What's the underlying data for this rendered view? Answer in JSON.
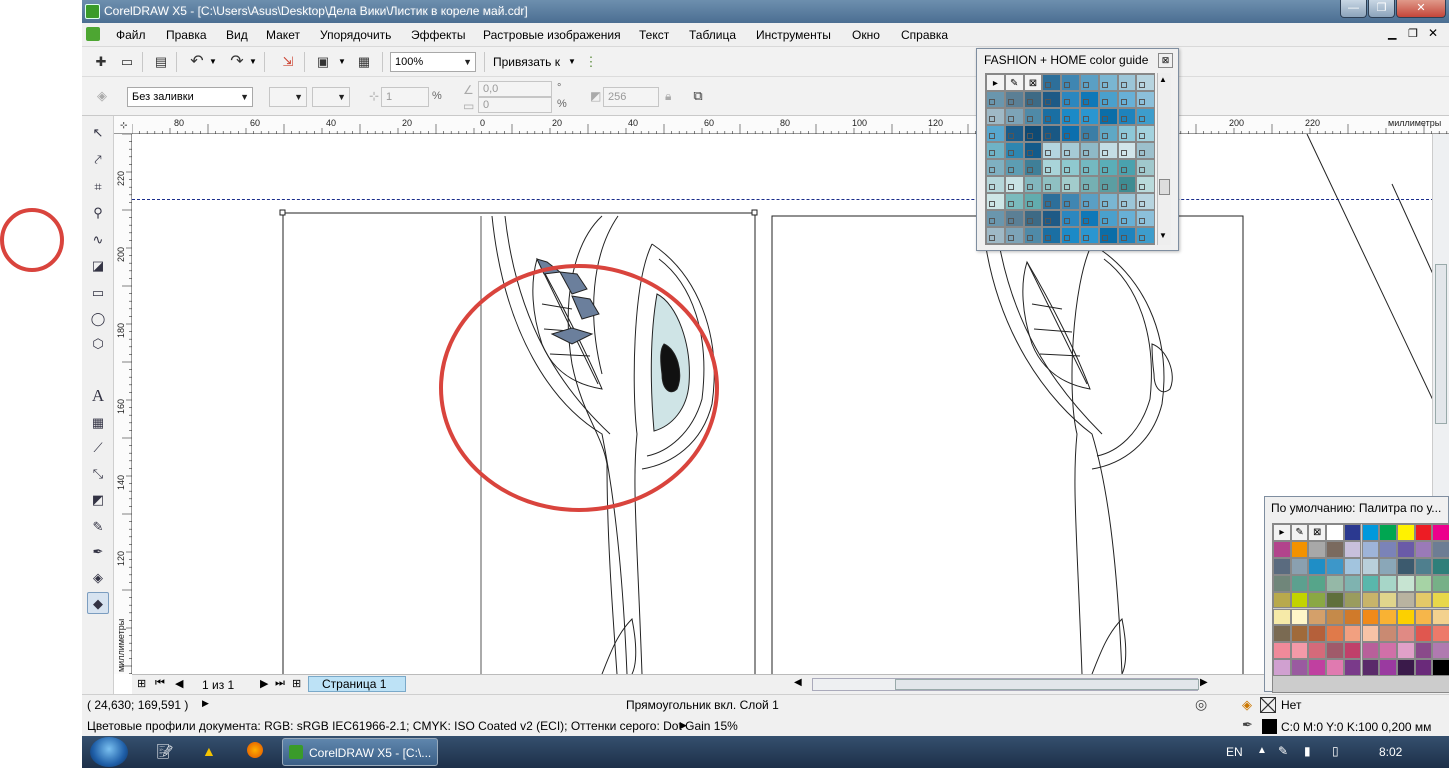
{
  "window": {
    "title": "CorelDRAW X5 - [C:\\Users\\Asus\\Desktop\\Дела Вики\\Листик в кореле май.cdr]",
    "min_glyph": "—",
    "max_glyph": "❐",
    "close_glyph": "✕"
  },
  "menu": {
    "items": [
      "Файл",
      "Правка",
      "Вид",
      "Макет",
      "Упорядочить",
      "Эффекты",
      "Растровые изображения",
      "Текст",
      "Таблица",
      "Инструменты",
      "Окно",
      "Справка"
    ]
  },
  "toolbar": {
    "zoom_value": "100%",
    "snap_label": "Привязать к"
  },
  "property_bar": {
    "fill_value": "Без заливки",
    "outline_width": "1",
    "percent_sign": "%",
    "value_a": "0,0",
    "value_b": "0",
    "angle_sign": "°",
    "percent2": "%",
    "count_value": "256"
  },
  "rulers": {
    "unit": "миллиметры",
    "h_labels": [
      "80",
      "60",
      "40",
      "20",
      "0",
      "20",
      "40",
      "60",
      "80",
      "100",
      "120",
      "200",
      "220"
    ],
    "v_labels": [
      "220",
      "200",
      "180",
      "160",
      "140",
      "120"
    ]
  },
  "page_nav": {
    "counter": "1 из 1",
    "page_tab": "Страница 1"
  },
  "status": {
    "coordinates": "( 24,630; 169,591 )",
    "selection": "Прямоугольник вкл. Слой 1",
    "color_profiles": "Цветовые профили документа: RGB: sRGB IEC61966-2.1; CMYK: ISO Coated v2 (ECI); Оттенки серого: Dot Gain 15%",
    "fill_status": "Нет",
    "outline_status": "C:0 M:0 Y:0 K:100  0,200 мм"
  },
  "palettes": {
    "fashion_title": "FASHION + HOME color guide",
    "default_title": "По умолчанию: Палитра по у...",
    "fashion_colors": [
      "#2d6f9a",
      "#3f86b2",
      "#5a9fc4",
      "#7ab6d2",
      "#9cc6d8",
      "#b7d4df",
      "#6a96ad",
      "#5b7f95",
      "#3d6a85",
      "#1e5a86",
      "#2b87bf",
      "#0f78b8",
      "#4aa0cc",
      "#68b0d6",
      "#8cc0da",
      "#9fb9c6",
      "#7da4b8",
      "#4f8aa8",
      "#1a6fa3",
      "#1b8ac7",
      "#2a96d0",
      "#0b6ea8",
      "#1e83bd",
      "#3d9dcc",
      "#57a7cf",
      "#1a5c8a",
      "#0e4a74",
      "#195884",
      "#0c6fae",
      "#3b7ea6",
      "#5fa8c5",
      "#8ec8d8",
      "#a3d2de",
      "#6fb3c6",
      "#2e86b0",
      "#135a8a",
      "#b4d5e0",
      "#a6cad6",
      "#8fb9c7",
      "#c4dde5",
      "#d1e5ea",
      "#9cc0cc",
      "#7fb0c1",
      "#5d9db3",
      "#3f7f98",
      "#a9d4d9",
      "#8fc9cf",
      "#74b9c1",
      "#5aaeb8",
      "#4aa2ae",
      "#a0c8cc",
      "#b6d7da",
      "#c8e2e4",
      "#82b7be",
      "#8fc0c2",
      "#a2cccc",
      "#75b0b3",
      "#5b9ea2",
      "#3f8c92",
      "#b9dadb",
      "#cde6e6",
      "#7bbbbd",
      "#62acae"
    ],
    "default_colors": [
      "#b2448c",
      "#f39200",
      "#a8a8a8",
      "#7a6a5f",
      "#c8c0dc",
      "#9eb4d8",
      "#7b83b8",
      "#6a5aa8",
      "#9a7ab8",
      "#6d7d94",
      "#5a6b7f",
      "#8aa0b0",
      "#1f8ec6",
      "#3d97c9",
      "#a2c4de",
      "#b9cfdb",
      "#8aa7b8",
      "#3c5a6e",
      "#4f7f8e",
      "#2f7f7a",
      "#70867a",
      "#5ca08f",
      "#56a58a",
      "#95b8a7",
      "#7fb3b0",
      "#59b7ac",
      "#a7d6c8",
      "#c7e4d2",
      "#a6d3a5",
      "#76b087",
      "#b8a94c",
      "#c2d300",
      "#8aa844",
      "#5f6f3c",
      "#9a9c5e",
      "#c8b46a",
      "#e0d58c",
      "#b9b3a0",
      "#e4c968",
      "#e8d74a",
      "#f6eaa8",
      "#fff6c8",
      "#d4a06a",
      "#c58a4a",
      "#d07a2a",
      "#f08a1a",
      "#f9b233",
      "#fcd000",
      "#f6b64a",
      "#f3d18e",
      "#7a6a52",
      "#a06a3a",
      "#b5603a",
      "#e07a4a",
      "#f2a080",
      "#f7c3a6",
      "#c98a72",
      "#e08a84",
      "#e0574f",
      "#ed7a6a",
      "#f08a9a",
      "#f49aa8",
      "#d46a7a",
      "#a05a6a",
      "#c0406a",
      "#b8609a",
      "#d070a8",
      "#e0a0c8",
      "#8a4a8a",
      "#b07ab0",
      "#d0a0d0",
      "#9a5aa0",
      "#c040a0",
      "#e07ab0",
      "#7a3a8a",
      "#5a2a6a",
      "#9a3aa0",
      "#3a1a4a",
      "#6a2a7a",
      "#000000"
    ]
  },
  "taskbar": {
    "task_label": "CorelDRAW X5 - [C:\\...",
    "lang": "EN",
    "clock": "8:02"
  }
}
